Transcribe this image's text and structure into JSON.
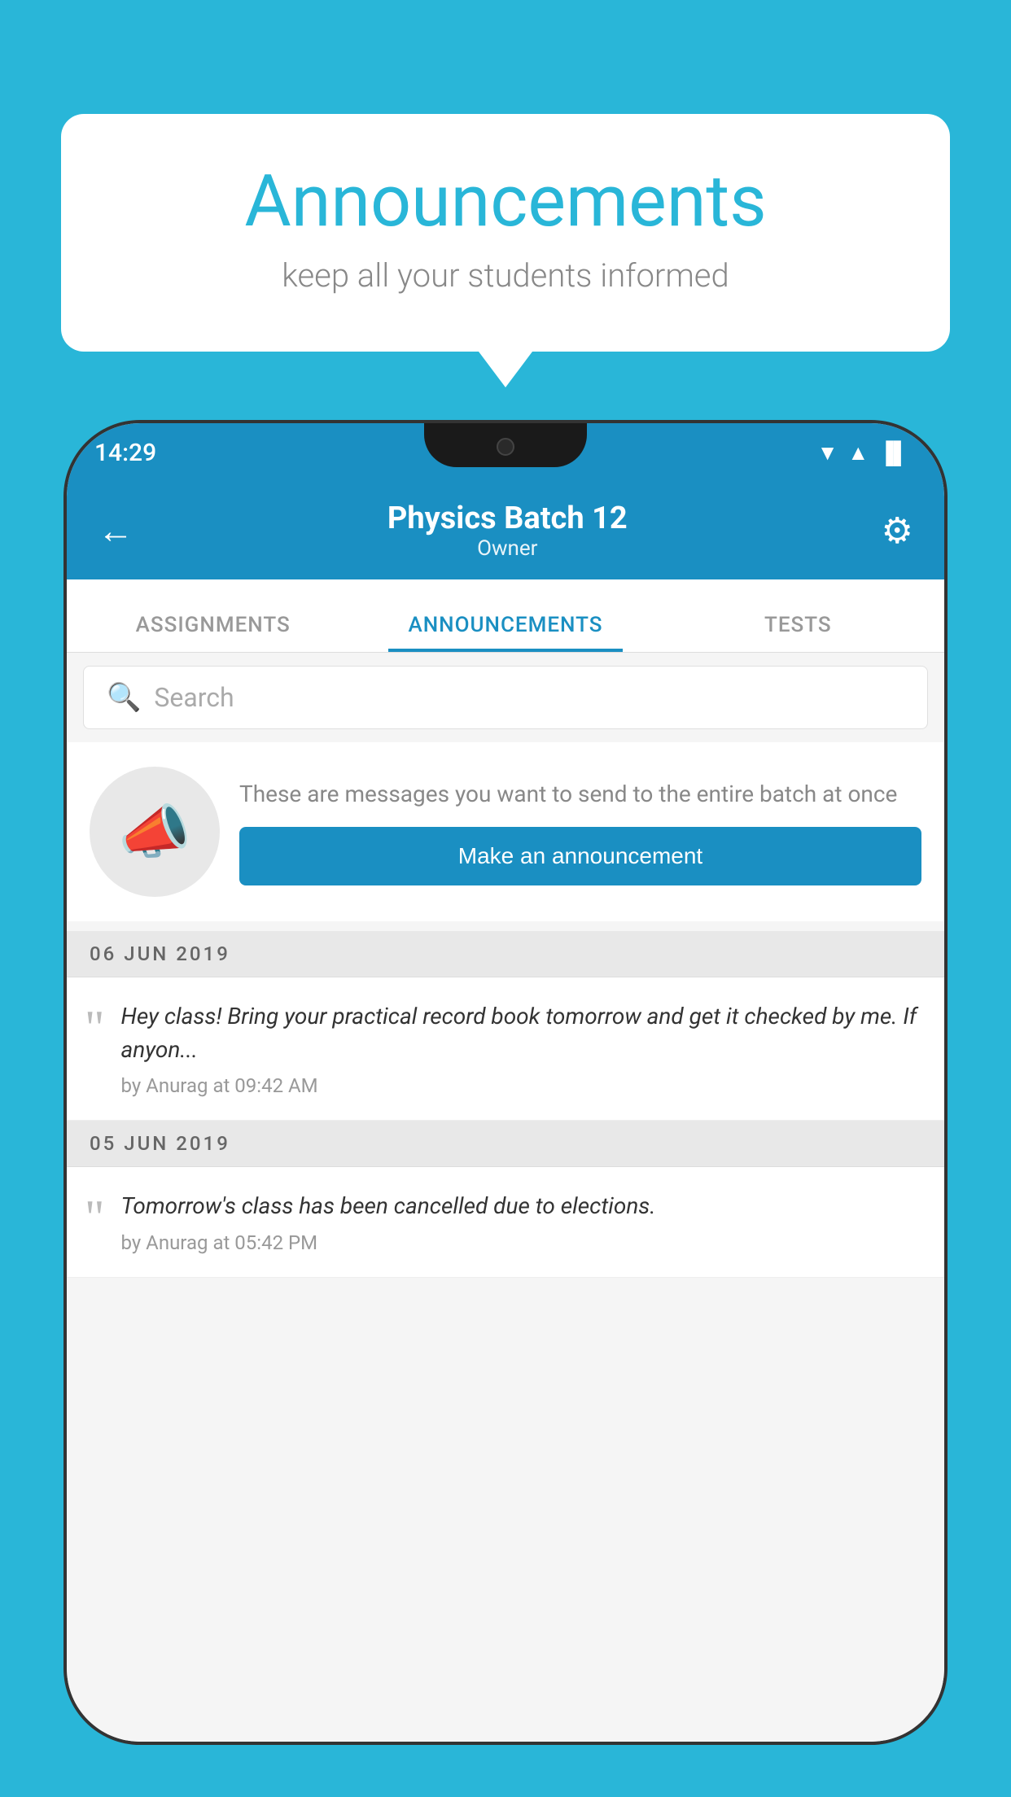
{
  "background_color": "#29B6D8",
  "bubble": {
    "title": "Announcements",
    "subtitle": "keep all your students informed"
  },
  "phone": {
    "status_bar": {
      "time": "14:29",
      "wifi": "▼",
      "signal": "▲",
      "battery": "▐"
    },
    "header": {
      "title": "Physics Batch 12",
      "subtitle": "Owner",
      "back_label": "←",
      "gear_label": "⚙"
    },
    "tabs": [
      {
        "label": "ASSIGNMENTS",
        "active": false
      },
      {
        "label": "ANNOUNCEMENTS",
        "active": true
      },
      {
        "label": "TESTS",
        "active": false
      }
    ],
    "search": {
      "placeholder": "Search"
    },
    "promo": {
      "description": "These are messages you want to send to the entire batch at once",
      "button_label": "Make an announcement"
    },
    "announcements": [
      {
        "date": "06  JUN  2019",
        "text": "Hey class! Bring your practical record book tomorrow and get it checked by me. If anyon...",
        "meta": "by Anurag at 09:42 AM"
      },
      {
        "date": "05  JUN  2019",
        "text": "Tomorrow's class has been cancelled due to elections.",
        "meta": "by Anurag at 05:42 PM"
      }
    ]
  }
}
